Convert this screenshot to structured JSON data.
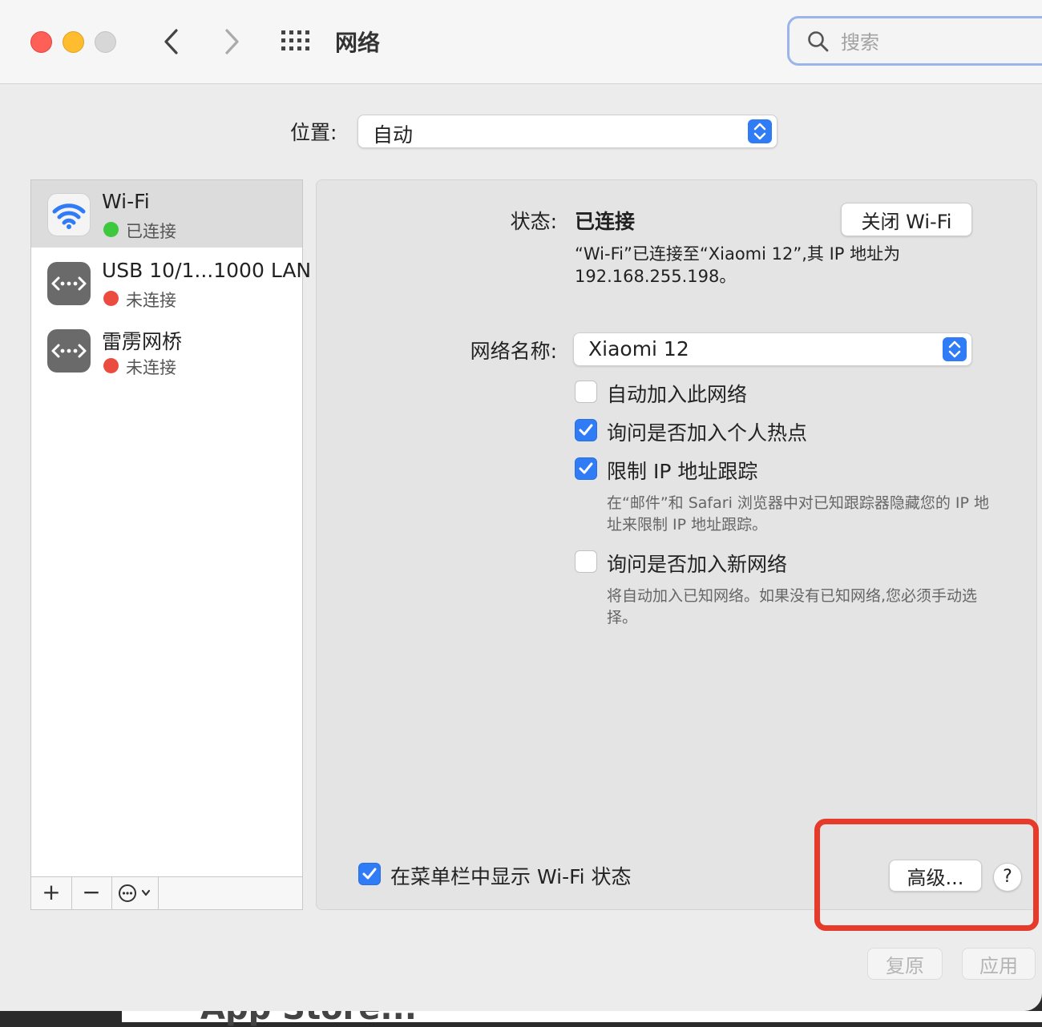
{
  "window": {
    "title": "网络",
    "search": {
      "placeholder": "搜索",
      "value": ""
    }
  },
  "location": {
    "label": "位置:",
    "value": "自动"
  },
  "services": [
    {
      "name": "Wi-Fi",
      "status": "已连接",
      "status_color": "#3dc83d",
      "icon": "wifi-icon"
    },
    {
      "name": "USB 10/1...1000 LAN",
      "status": "未连接",
      "status_color": "#ec4b3f",
      "icon": "ethernet-icon"
    },
    {
      "name": "雷雳网桥",
      "status": "未连接",
      "status_color": "#ec4b3f",
      "icon": "ethernet-icon"
    }
  ],
  "sidebar_toolbar": {
    "add": "+",
    "remove": "−"
  },
  "detail": {
    "status_label": "状态:",
    "status_value": "已连接",
    "turn_off_button": "关闭 Wi-Fi",
    "status_description": "“Wi-Fi”已连接至“Xiaomi 12”,其 IP 地址为 192.168.255.198。",
    "network_name_label": "网络名称:",
    "network_name_value": "Xiaomi 12",
    "options": [
      {
        "label": "自动加入此网络",
        "checked": false
      },
      {
        "label": "询问是否加入个人热点",
        "checked": true
      },
      {
        "label": "限制 IP 地址跟踪",
        "checked": true,
        "hint": "在“邮件”和 Safari 浏览器中对已知跟踪器隐藏您的 IP 地址来限制 IP 地址跟踪。"
      },
      {
        "label": "询问是否加入新网络",
        "checked": false,
        "hint": "将自动加入已知网络。如果没有已知网络,您必须手动选择。"
      }
    ],
    "show_in_menubar": {
      "label": "在菜单栏中显示 Wi-Fi 状态",
      "checked": true
    },
    "advanced_button": "高级...",
    "help_button": "?"
  },
  "footer": {
    "revert_button": "复原",
    "apply_button": "应用"
  },
  "colors": {
    "accent": "#2f7cf6",
    "highlight": "#e63a2a"
  },
  "background_text": "App Store..."
}
